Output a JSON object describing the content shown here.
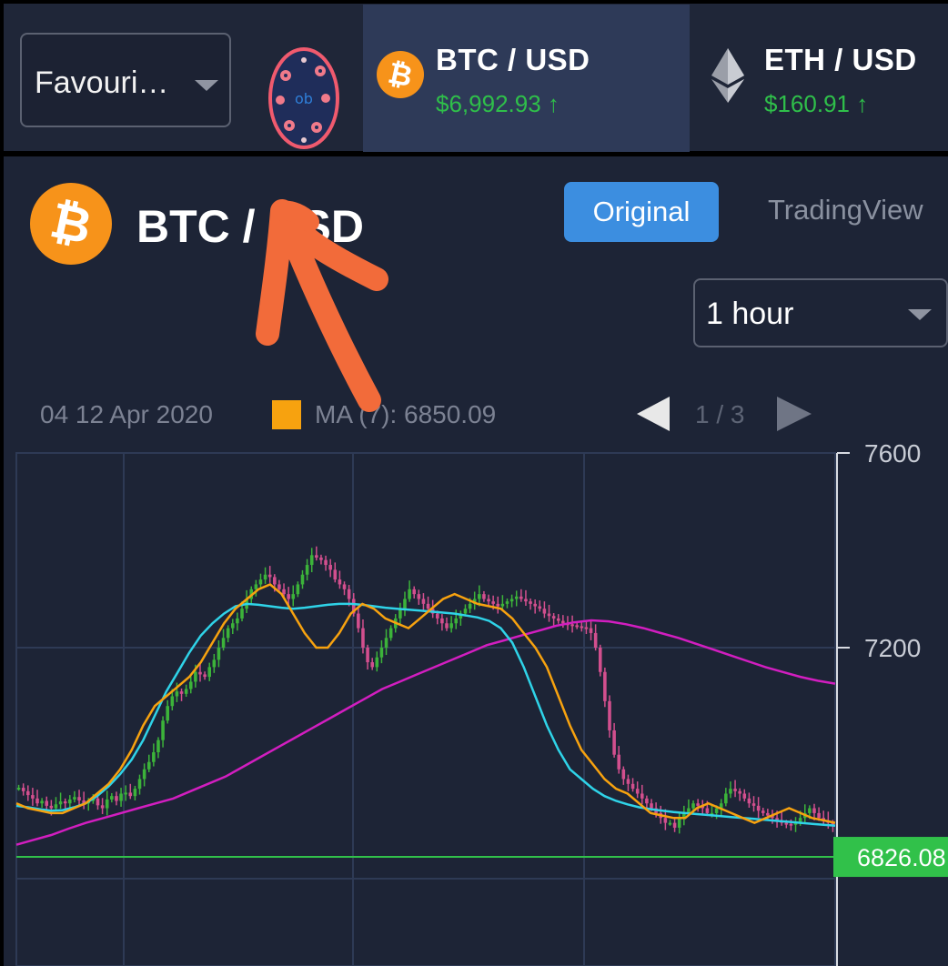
{
  "colors": {
    "up": "#3cb33a",
    "down": "#d24f8e",
    "ma7": "#f7a20f",
    "ma25": "#2fd3e8",
    "ma99": "#d21ec0",
    "last_price_line": "#31c14a",
    "accent": "#3c8ee0"
  },
  "header": {
    "favourites_select": "Favouri…",
    "tickers": [
      {
        "pair": "BTC / USD",
        "price": "$6,992.93 ↑",
        "icon": "bitcoin-icon",
        "active": true
      },
      {
        "pair": "ETH / USD",
        "price": "$160.91 ↑",
        "icon": "ethereum-icon",
        "active": false
      }
    ]
  },
  "main": {
    "title": "BTC / USD",
    "tabs": [
      "Original",
      "TradingView"
    ],
    "interval": "1 hour",
    "info": {
      "date": "04 12 Apr 2020",
      "ma_label": "MA (7): 6850.09",
      "page": "1 / 3"
    }
  },
  "chart_data": {
    "type": "candlestick",
    "y_ticks": [
      "7600",
      "7200"
    ],
    "y_range": [
      6820,
      7620
    ],
    "last_price": "6826.08",
    "last_price_value": 6826.08,
    "grid": true,
    "candles_close": [
      6912,
      6905,
      6897,
      6890,
      6880,
      6885,
      6875,
      6870,
      6878,
      6884,
      6880,
      6888,
      6893,
      6886,
      6880,
      6885,
      6890,
      6876,
      6870,
      6888,
      6895,
      6885,
      6900,
      6902,
      6895,
      6910,
      6930,
      6950,
      6965,
      6985,
      7010,
      7050,
      7080,
      7100,
      7110,
      7105,
      7115,
      7130,
      7150,
      7145,
      7140,
      7160,
      7175,
      7200,
      7220,
      7240,
      7250,
      7260,
      7280,
      7300,
      7320,
      7330,
      7340,
      7350,
      7345,
      7330,
      7320,
      7310,
      7300,
      7310,
      7330,
      7350,
      7370,
      7390,
      7385,
      7380,
      7370,
      7360,
      7340,
      7330,
      7320,
      7300,
      7270,
      7240,
      7200,
      7170,
      7160,
      7180,
      7200,
      7220,
      7240,
      7260,
      7280,
      7300,
      7320,
      7310,
      7300,
      7290,
      7280,
      7270,
      7260,
      7250,
      7240,
      7250,
      7260,
      7270,
      7280,
      7290,
      7300,
      7310,
      7300,
      7295,
      7290,
      7285,
      7290,
      7295,
      7300,
      7305,
      7300,
      7295,
      7290,
      7285,
      7280,
      7270,
      7265,
      7260,
      7255,
      7250,
      7248,
      7246,
      7244,
      7242,
      7240,
      7230,
      7200,
      7150,
      7090,
      7030,
      6980,
      6950,
      6930,
      6920,
      6910,
      6900,
      6890,
      6880,
      6870,
      6860,
      6850,
      6840,
      6840,
      6830,
      6850,
      6860,
      6870,
      6880,
      6875,
      6870,
      6860,
      6860,
      6870,
      6880,
      6900,
      6910,
      6905,
      6900,
      6890,
      6880,
      6875,
      6865,
      6860,
      6855,
      6850,
      6845,
      6840,
      6838,
      6836,
      6840,
      6850,
      6860,
      6870,
      6860,
      6850,
      6845,
      6840,
      6836
    ],
    "ma7": [
      6880,
      6870,
      6865,
      6860,
      6860,
      6870,
      6880,
      6900,
      6920,
      6950,
      6990,
      7040,
      7080,
      7100,
      7120,
      7140,
      7170,
      7210,
      7250,
      7280,
      7300,
      7320,
      7330,
      7310,
      7270,
      7230,
      7200,
      7200,
      7230,
      7270,
      7290,
      7280,
      7260,
      7250,
      7240,
      7260,
      7280,
      7300,
      7310,
      7300,
      7290,
      7285,
      7280,
      7260,
      7230,
      7200,
      7160,
      7100,
      7040,
      6990,
      6960,
      6930,
      6910,
      6900,
      6880,
      6860,
      6855,
      6850,
      6850,
      6870,
      6880,
      6870,
      6860,
      6850,
      6840,
      6850,
      6860,
      6870,
      6860,
      6850,
      6845,
      6840
    ],
    "ma25": [
      6875,
      6872,
      6868,
      6865,
      6866,
      6872,
      6880,
      6895,
      6915,
      6940,
      6970,
      7010,
      7060,
      7110,
      7150,
      7190,
      7225,
      7250,
      7270,
      7285,
      7290,
      7288,
      7285,
      7282,
      7280,
      7282,
      7285,
      7288,
      7290,
      7290,
      7288,
      7285,
      7282,
      7280,
      7278,
      7276,
      7274,
      7272,
      7270,
      7266,
      7262,
      7255,
      7240,
      7210,
      7160,
      7100,
      7040,
      6990,
      6950,
      6930,
      6910,
      6895,
      6885,
      6878,
      6872,
      6868,
      6865,
      6862,
      6860,
      6858,
      6856,
      6854,
      6852,
      6850,
      6848,
      6846,
      6844,
      6842,
      6840,
      6838,
      6836,
      6834
    ],
    "ma99": [
      6795,
      6805,
      6815,
      6828,
      6840,
      6850,
      6860,
      6870,
      6880,
      6890,
      6905,
      6920,
      6935,
      6955,
      6975,
      6995,
      7015,
      7035,
      7055,
      7075,
      7095,
      7115,
      7130,
      7145,
      7160,
      7175,
      7190,
      7205,
      7215,
      7225,
      7235,
      7245,
      7252,
      7256,
      7254,
      7248,
      7240,
      7230,
      7220,
      7208,
      7196,
      7184,
      7172,
      7160,
      7150,
      7140,
      7132,
      7126
    ]
  }
}
